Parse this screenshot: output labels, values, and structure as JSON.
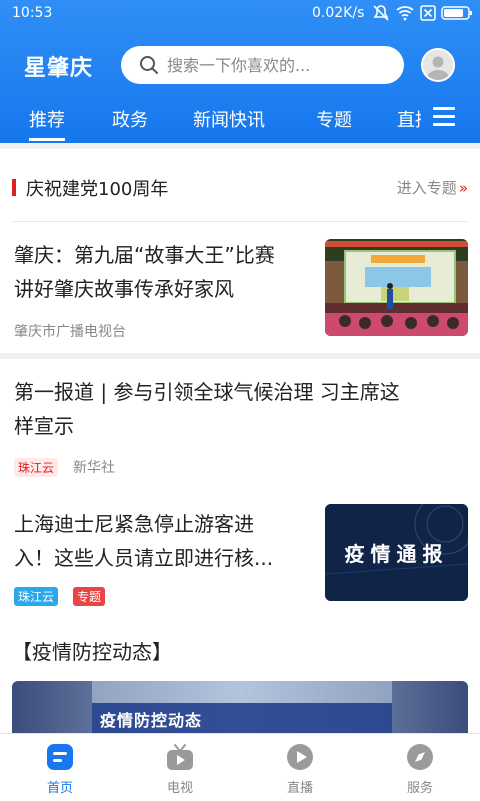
{
  "statusbar": {
    "time": "10:53",
    "speed": "0.02K/s"
  },
  "header": {
    "logo": "星肇庆",
    "search_placeholder": "搜索一下你喜欢的..."
  },
  "tabs": [
    "推荐",
    "政务",
    "新闻快讯",
    "专题",
    "直播"
  ],
  "special": {
    "title": "庆祝建党100周年",
    "more": "进入专题"
  },
  "news": [
    {
      "title_line1": "肇庆：第九届“故事大王”比赛",
      "title_line2": "讲好肇庆故事传承好家风",
      "source": "肇庆市广播电视台"
    },
    {
      "title_line1": "第一报道 | 参与引领全球气候治理 习主席这",
      "title_line2": "样宣示",
      "tag": "珠江云",
      "source": "新华社"
    },
    {
      "title_line1": "上海迪士尼紧急停止游客进",
      "title_line2": "入！这些人员请立即进行核...",
      "tags": [
        "珠江云",
        "专题"
      ],
      "thumb_text": "疫情通报"
    }
  ],
  "section": {
    "title": "【疫情防控动态】",
    "banner_text": "疫情防控动态"
  },
  "bottomnav": [
    "首页",
    "电视",
    "直播",
    "服务"
  ],
  "colors": {
    "primary": "#1677ee",
    "accent_red": "#e02020",
    "tag_blue": "#29a9ea"
  }
}
